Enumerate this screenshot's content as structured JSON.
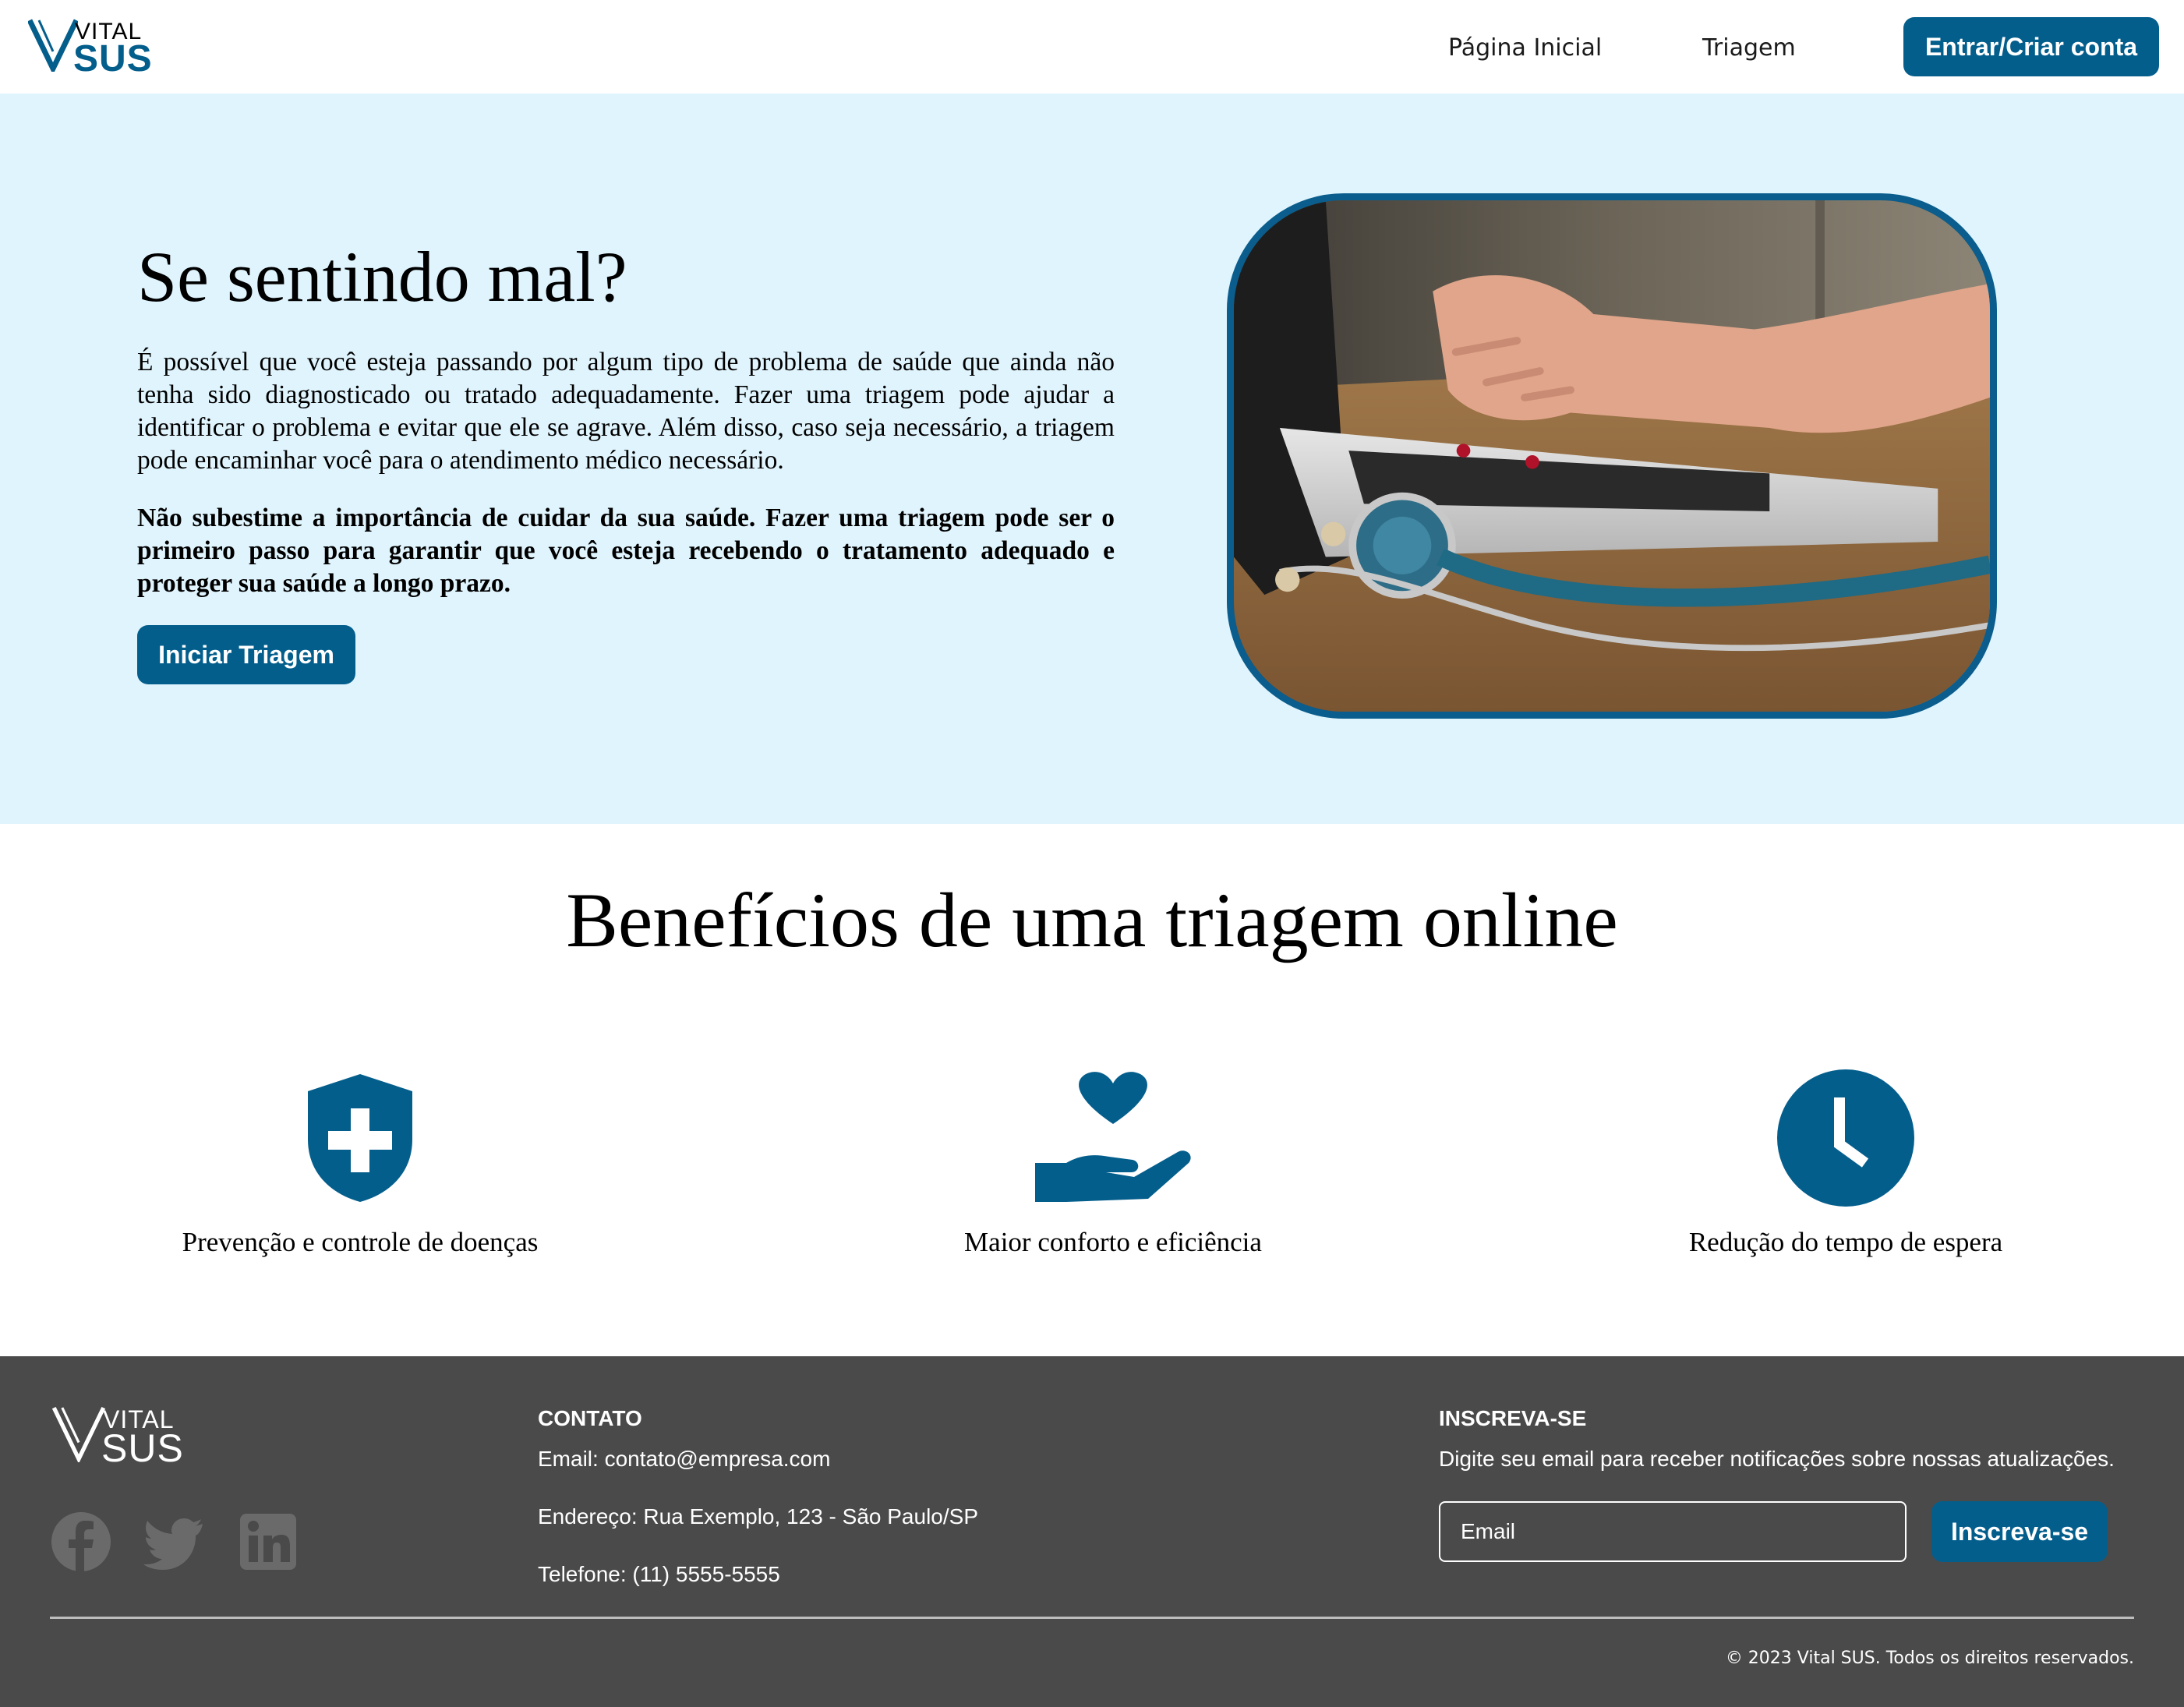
{
  "brand": {
    "logo_top": "VITAL",
    "logo_bottom": "SUS",
    "primary_color": "#045e8c",
    "hero_bg": "#e0f4fd",
    "footer_bg": "#4a4a4a"
  },
  "nav": {
    "home_label": "Página Inicial",
    "triagem_label": "Triagem",
    "login_label": "Entrar/Criar conta"
  },
  "hero": {
    "title": "Se sentindo mal?",
    "paragraph_1": "É possível que você esteja passando por algum tipo de problema de saúde que ainda não tenha sido diagnosticado ou tratado adequadamente. Fazer uma triagem pode ajudar a identificar o problema e evitar que ele se agrave. Além disso, caso seja necessário, a triagem pode encaminhar você para o atendimento médico necessário.",
    "paragraph_2": "Não subestime a importância de cuidar da sua saúde. Fazer uma triagem pode ser o primeiro passo para garantir que você esteja recebendo o tratamento adequado e proteger sua saúde a longo prazo.",
    "cta_label": "Iniciar Triagem",
    "image_icon": "laptop-stethoscope-photo"
  },
  "benefits": {
    "title": "Benefícios de uma triagem online",
    "items": [
      {
        "icon": "shield-plus-icon",
        "label": "Prevenção e controle de doenças"
      },
      {
        "icon": "hand-heart-icon",
        "label": "Maior conforto e eficiência"
      },
      {
        "icon": "clock-icon",
        "label": "Redução do tempo de espera"
      }
    ]
  },
  "footer": {
    "social_icons": [
      "facebook-icon",
      "twitter-icon",
      "linkedin-icon"
    ],
    "contact_heading": "CONTATO",
    "email": "Email: contato@empresa.com",
    "address": "Endereço: Rua Exemplo, 123 - São Paulo/SP",
    "phone": "Telefone: (11) 5555-5555",
    "subscribe_heading": "INSCREVA-SE",
    "subscribe_text": "Digite seu email para receber notificações sobre nossas atualizações.",
    "email_placeholder": "Email",
    "subscribe_label": "Inscreva-se",
    "copyright": "© 2023 Vital SUS. Todos os direitos reservados."
  }
}
